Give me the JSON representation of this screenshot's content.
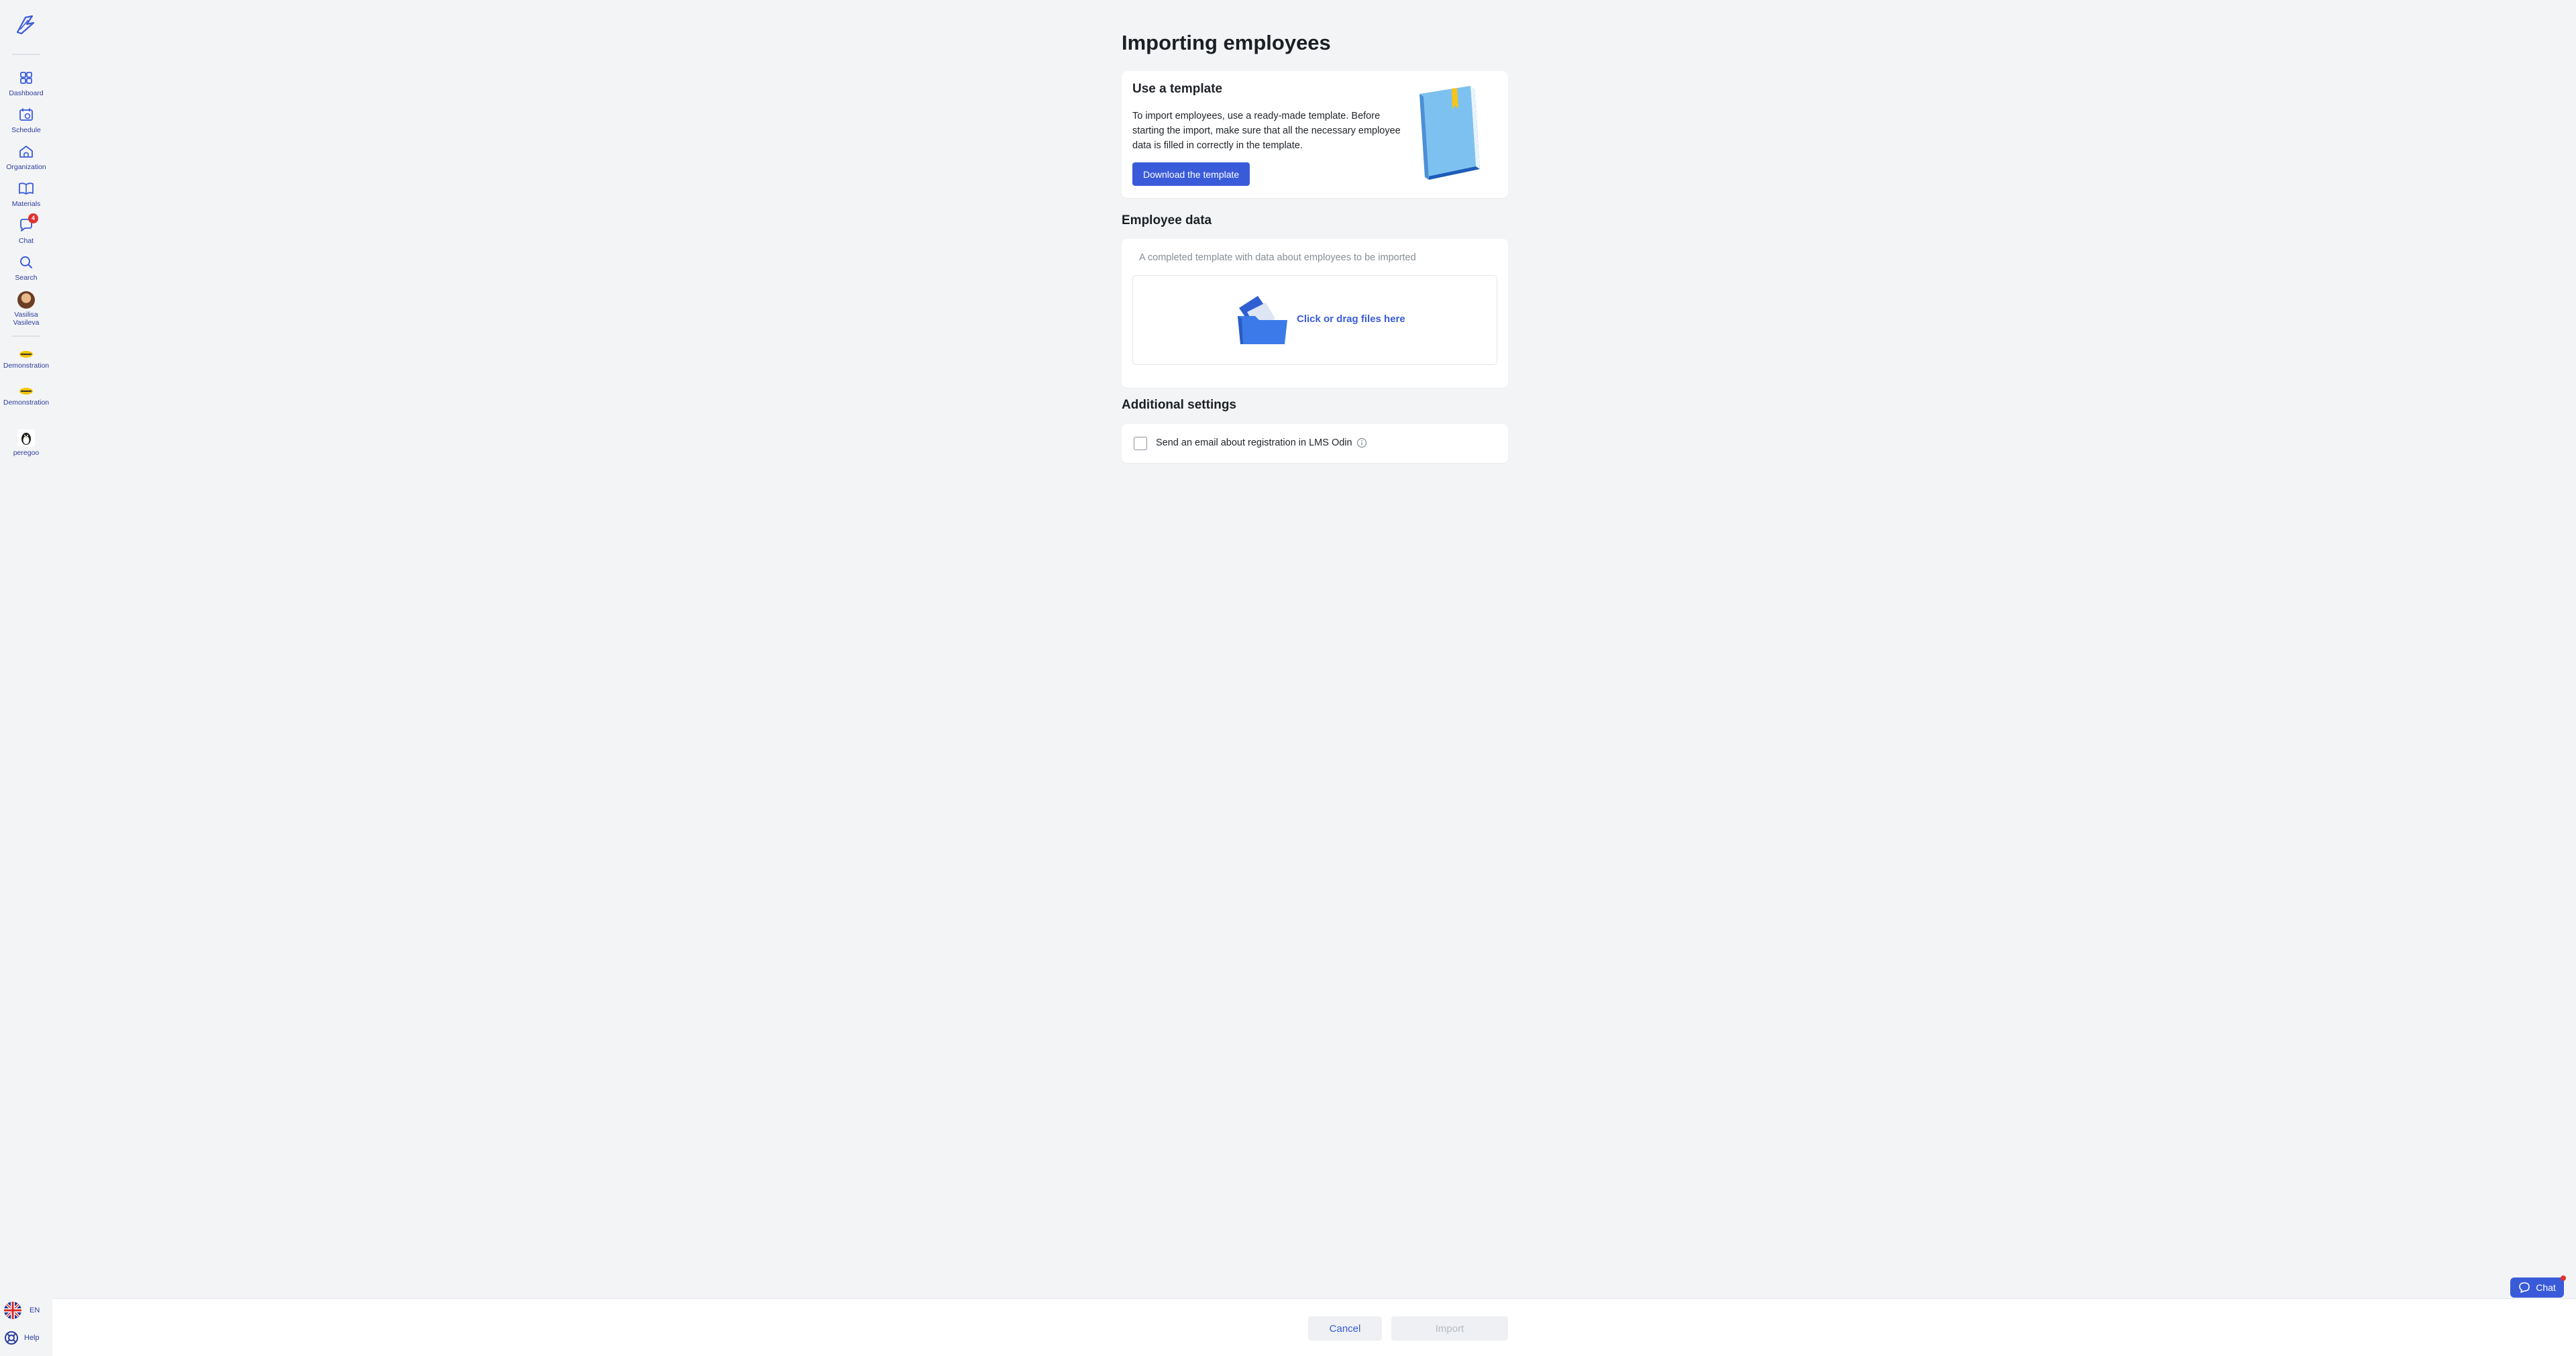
{
  "sidebar": {
    "nav": [
      {
        "label": "Dashboard",
        "icon": "grid-icon"
      },
      {
        "label": "Schedule",
        "icon": "calendar-icon"
      },
      {
        "label": "Organization",
        "icon": "home-icon"
      },
      {
        "label": "Materials",
        "icon": "book-icon"
      },
      {
        "label": "Chat",
        "icon": "chat-icon",
        "badge": "4"
      },
      {
        "label": "Search",
        "icon": "search-icon"
      }
    ],
    "user": {
      "name": "Vasilisa Vasileva"
    },
    "organizations": [
      {
        "label": "Demonstration"
      },
      {
        "label": "Demonstration"
      },
      {
        "label": "peregoo"
      }
    ],
    "language": "EN",
    "help": "Help"
  },
  "page": {
    "title": "Importing employees"
  },
  "template_card": {
    "title": "Use a template",
    "description": "To import employees, use a ready-made template. Before starting the import, make sure that all the necessary employee data is filled in correctly in the template.",
    "button": "Download the template"
  },
  "employee_data": {
    "title": "Employee data",
    "hint": "A completed template with data about employees to be imported",
    "dropzone": "Click or drag files here"
  },
  "additional": {
    "title": "Additional settings",
    "email_checkbox": "Send an email about registration in LMS Odin",
    "checked": false
  },
  "footer": {
    "cancel": "Cancel",
    "import": "Import"
  },
  "chat_widget": {
    "label": "Chat"
  },
  "colors": {
    "accent": "#3a5bd9",
    "background": "#f3f4f6",
    "card": "#ffffff",
    "badge": "#e03131"
  }
}
